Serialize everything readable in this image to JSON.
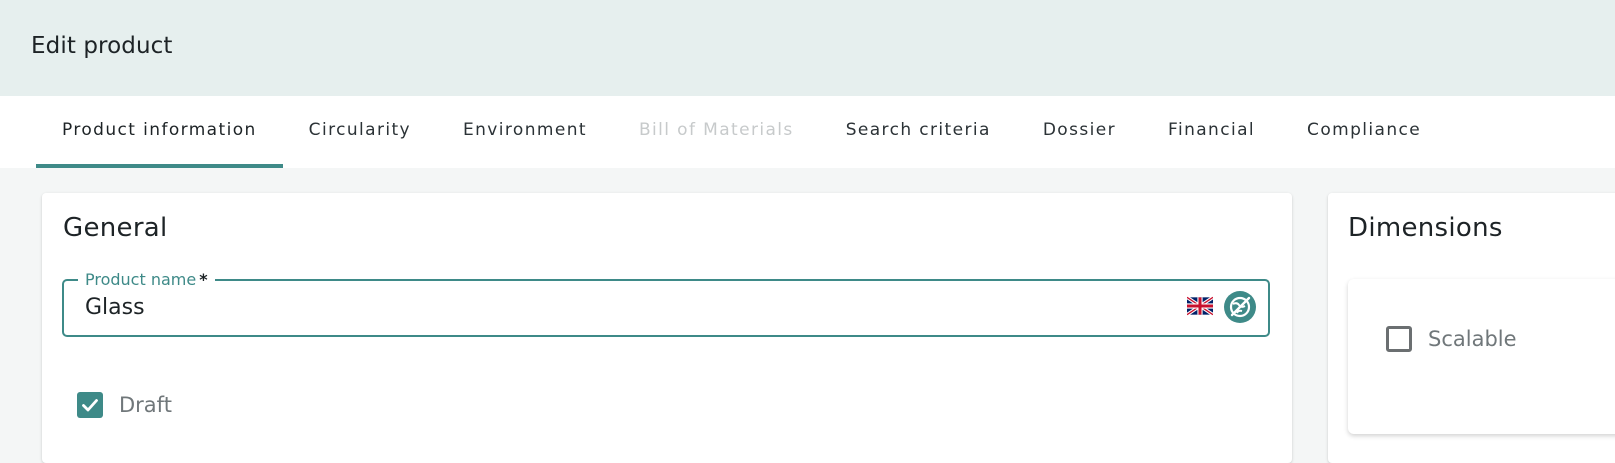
{
  "header": {
    "title": "Edit product"
  },
  "tabs": [
    {
      "label": "Product information",
      "state": "active"
    },
    {
      "label": "Circularity",
      "state": "normal"
    },
    {
      "label": "Environment",
      "state": "normal"
    },
    {
      "label": "Bill of Materials",
      "state": "disabled"
    },
    {
      "label": "Search criteria",
      "state": "normal"
    },
    {
      "label": "Dossier",
      "state": "normal"
    },
    {
      "label": "Financial",
      "state": "normal"
    },
    {
      "label": "Compliance",
      "state": "normal"
    }
  ],
  "general": {
    "title": "General",
    "product_name": {
      "label": "Product name",
      "required": "*",
      "value": "Glass",
      "language_icon": "uk-flag-icon",
      "translate_icon": "translate-off-icon"
    },
    "draft": {
      "label": "Draft",
      "checked": true
    }
  },
  "dimensions": {
    "title": "Dimensions",
    "scalable": {
      "label": "Scalable",
      "checked": false
    }
  },
  "colors": {
    "accent": "#3e8a88",
    "header_bg": "#e6efee",
    "disabled_text": "#c7cacb"
  }
}
